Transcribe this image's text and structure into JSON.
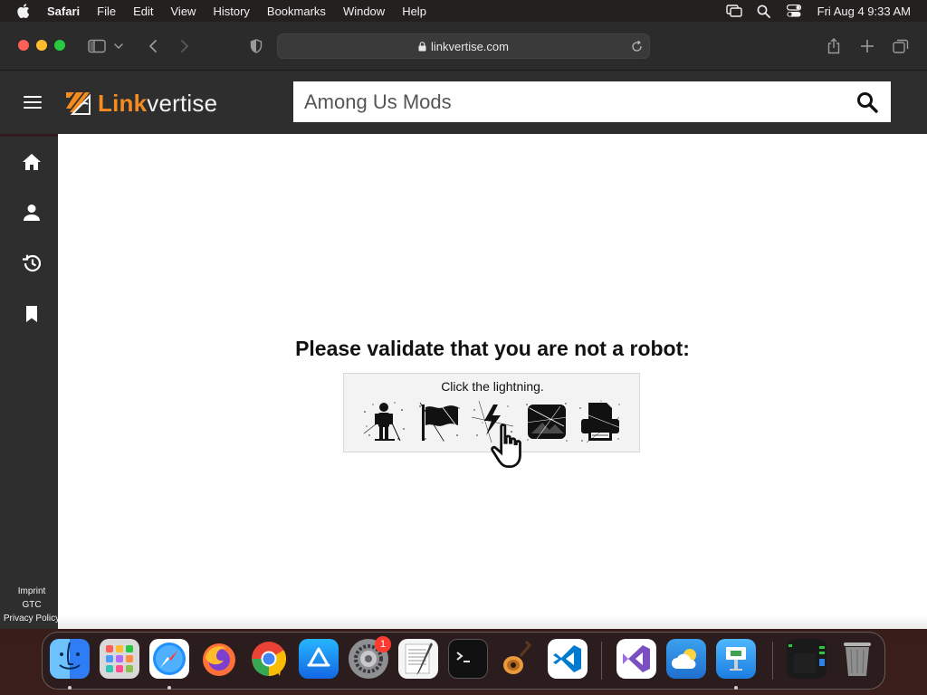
{
  "menubar": {
    "app_name": "Safari",
    "menus": [
      "File",
      "Edit",
      "View",
      "History",
      "Bookmarks",
      "Window",
      "Help"
    ],
    "clock": "Fri Aug 4  9:33 AM"
  },
  "browser": {
    "url": "linkvertise.com"
  },
  "site": {
    "logo_link": "Link",
    "logo_vertise": "vertise",
    "search_value": "Among Us Mods",
    "brand_color": "#f68b1f"
  },
  "sidebar": {
    "items": [
      {
        "icon": "home-icon"
      },
      {
        "icon": "profile-icon"
      },
      {
        "icon": "history-icon"
      },
      {
        "icon": "bookmark-icon"
      }
    ],
    "footer": [
      "Imprint",
      "GTC",
      "Privacy Policy"
    ]
  },
  "captcha": {
    "title": "Please validate that you are not a robot:",
    "instruction": "Click the lightning.",
    "choices": [
      "person",
      "flag",
      "lightning",
      "image",
      "printer"
    ]
  },
  "dock": {
    "apps": [
      {
        "name": "Finder",
        "color": "#2e7cf6"
      },
      {
        "name": "Launchpad",
        "color": "#c0c0c0"
      },
      {
        "name": "Safari",
        "color": "#1e90ff"
      },
      {
        "name": "Firefox",
        "color": "#ff7139"
      },
      {
        "name": "Chrome",
        "color": "#34a853"
      },
      {
        "name": "App Store",
        "color": "#1c8cf3"
      },
      {
        "name": "System Settings",
        "color": "#8e8e93"
      },
      {
        "name": "TextEdit",
        "color": "#f5f5f5"
      },
      {
        "name": "Terminal",
        "color": "#111111"
      },
      {
        "name": "GarageBand",
        "color": "#e89a3c"
      },
      {
        "name": "Visual Studio Code",
        "color": "#007acc"
      },
      {
        "name": "Visual Studio",
        "color": "#7b4fc2"
      },
      {
        "name": "Weather",
        "color": "#3ba1ee"
      },
      {
        "name": "Keynote",
        "color": "#2a9df4"
      },
      {
        "name": "Activity Monitor",
        "color": "#1a1a1a"
      },
      {
        "name": "Trash",
        "color": "#9a9a9a"
      }
    ],
    "settings_badge": "1"
  }
}
